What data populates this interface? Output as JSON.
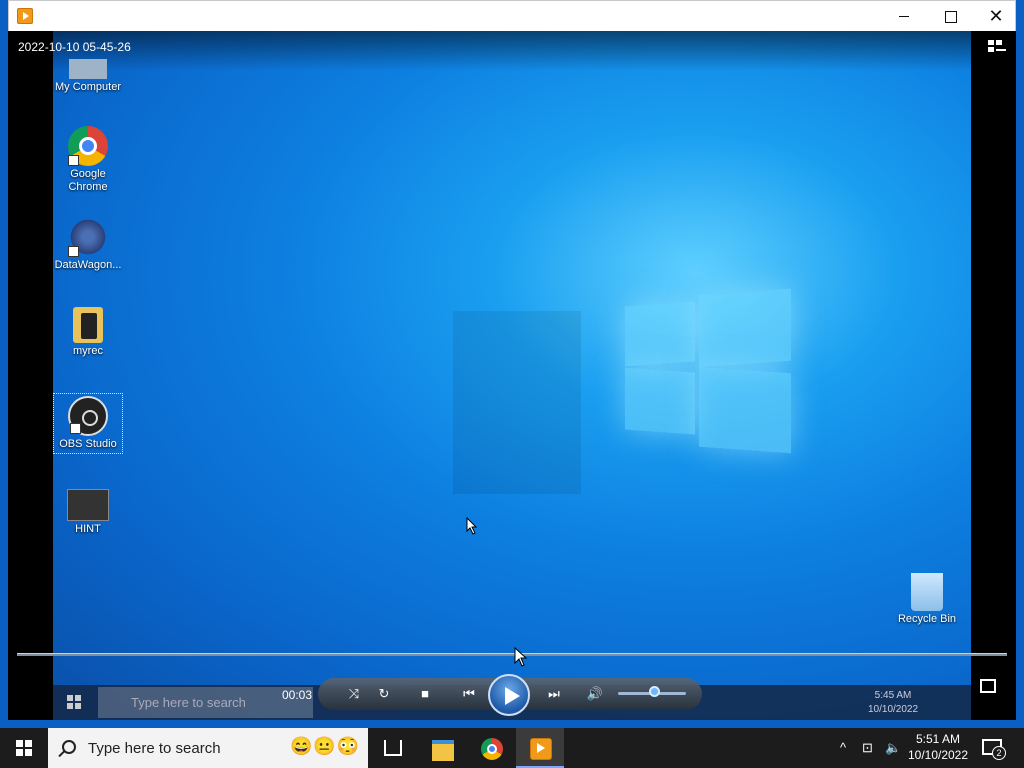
{
  "window": {
    "title_icon": "media-player-icon",
    "controls": {
      "minimize": "minimize-icon",
      "maximize": "maximize-icon",
      "close": "close-icon"
    }
  },
  "player": {
    "timestamp": "2022-10-10 05-45-26",
    "current_time": "00:03",
    "volume_level": 0.55,
    "state": "paused"
  },
  "video_desktop": {
    "icons": [
      {
        "label": "My Computer"
      },
      {
        "label": "Google Chrome"
      },
      {
        "label": "DataWagon..."
      },
      {
        "label": "myrec"
      },
      {
        "label": "OBS Studio"
      },
      {
        "label": "HINT"
      },
      {
        "label": "Recycle Bin"
      }
    ],
    "taskbar": {
      "search_placeholder": "Type here to search",
      "time": "5:45 AM",
      "date": "10/10/2022"
    }
  },
  "taskbar": {
    "search_placeholder": "Type here to search",
    "time": "5:51 AM",
    "date": "10/10/2022",
    "notification_count": "2",
    "colors": {
      "background": "#1c1c1c",
      "active_underline": "#7aa8ff"
    }
  }
}
